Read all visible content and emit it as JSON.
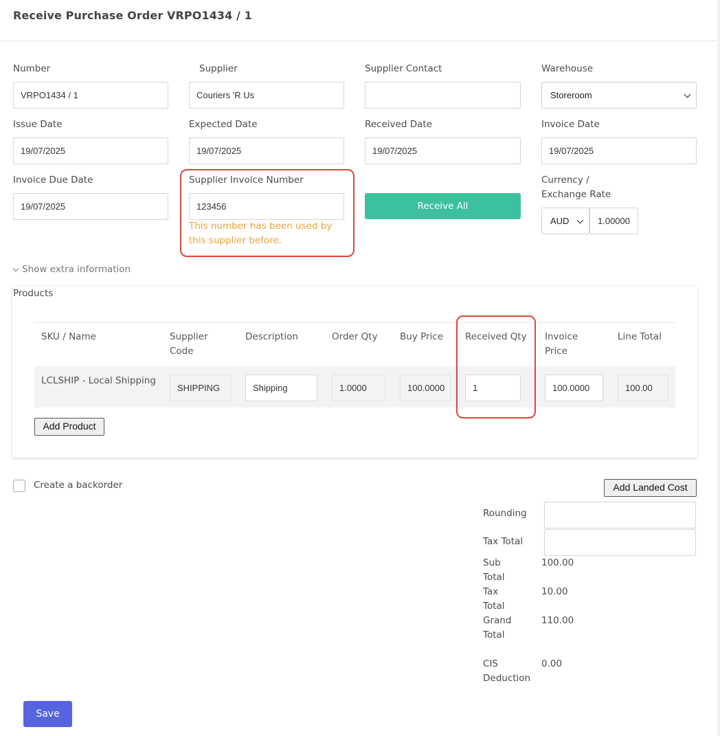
{
  "page": {
    "title": "Receive Purchase Order VRPO1434 / 1"
  },
  "header_fields": {
    "number": {
      "label": "Number",
      "value": "VRPO1434 / 1"
    },
    "supplier": {
      "label": "Supplier",
      "value": "Couriers 'R Us"
    },
    "supplier_contact": {
      "label": "Supplier Contact",
      "value": ""
    },
    "warehouse": {
      "label": "Warehouse",
      "value": "Storeroom"
    },
    "issue_date": {
      "label": "Issue Date",
      "value": "19/07/2025"
    },
    "expected_date": {
      "label": "Expected Date",
      "value": "19/07/2025"
    },
    "received_date": {
      "label": "Received Date",
      "value": "19/07/2025"
    },
    "invoice_date": {
      "label": "Invoice Date",
      "value": "19/07/2025"
    },
    "invoice_due_date": {
      "label": "Invoice Due Date",
      "value": "19/07/2025"
    },
    "supplier_invoice_number": {
      "label": "Supplier Invoice Number",
      "value": "123456",
      "warning_line1": "This number has been used by",
      "warning_line2": "this supplier before."
    },
    "receive_all_label": "Receive All",
    "currency": {
      "label_line1": "Currency /",
      "label_line2": "Exchange Rate",
      "value": "AUD",
      "rate": "1.00000"
    }
  },
  "extra_info_toggle": "Show extra information",
  "products": {
    "heading": "Products",
    "columns": {
      "sku_name": "SKU / Name",
      "supplier_code_l1": "Supplier",
      "supplier_code_l2": "Code",
      "description": "Description",
      "order_qty": "Order Qty",
      "buy_price": "Buy Price",
      "received_qty": "Received Qty",
      "invoice_price_l1": "Invoice",
      "invoice_price_l2": "Price",
      "line_total": "Line Total"
    },
    "rows": [
      {
        "sku_name": "LCLSHIP - Local Shipping",
        "supplier_code": "SHIPPING",
        "description": "Shipping",
        "order_qty": "1.0000",
        "buy_price": "100.0000",
        "received_qty": "1",
        "invoice_price": "100.0000",
        "line_total": "100.00"
      }
    ],
    "add_product_label": "Add Product"
  },
  "backorder": {
    "label": "Create a backorder",
    "checked": false
  },
  "add_landed_cost_label": "Add Landed Cost",
  "totals": {
    "rounding_label": "Rounding",
    "rounding_value": "",
    "tax_total_label": "Tax Total",
    "tax_total_value": "",
    "sub_total_l1": "Sub",
    "sub_total_l2": "Total",
    "sub_total_value": "100.00",
    "tax_l1": "Tax",
    "tax_l2": "Total",
    "tax_value": "10.00",
    "grand_l1": "Grand",
    "grand_l2": "Total",
    "grand_value": "110.00",
    "cis_l1": "CIS",
    "cis_l2": "Deduction",
    "cis_value": "0.00"
  },
  "save_label": "Save",
  "colors": {
    "primary": "#5764e0",
    "success": "#3cc0a0",
    "warning": "#e8a33a",
    "highlight": "#d8483a"
  }
}
